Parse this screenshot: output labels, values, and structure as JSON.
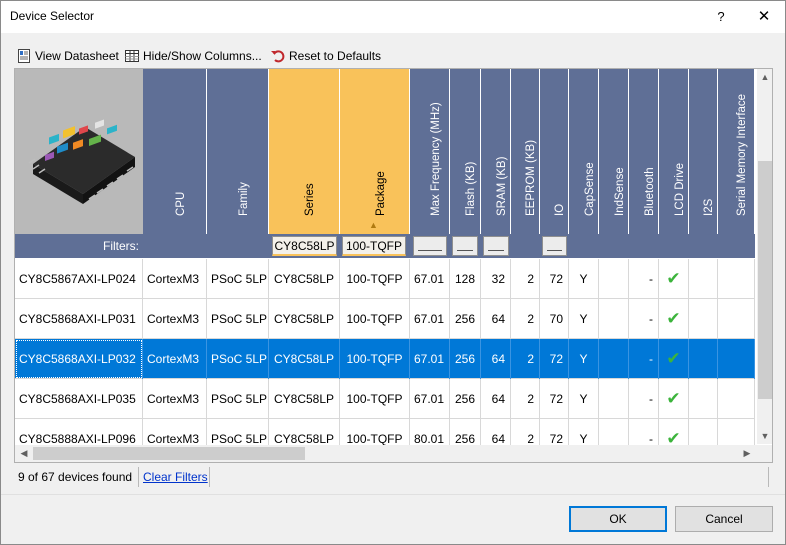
{
  "window": {
    "title": "Device Selector",
    "help_glyph": "?",
    "close_glyph": "✕"
  },
  "toolbar": {
    "view_datasheet": "View Datasheet",
    "hide_show_columns": "Hide/Show Columns...",
    "reset_defaults": "Reset to Defaults"
  },
  "columns": [
    "CPU",
    "Family",
    "Series",
    "Package",
    "Max Frequency (MHz)",
    "Flash (KB)",
    "SRAM (KB)",
    "EEPROM (KB)",
    "IO",
    "CapSense",
    "IndSense",
    "Bluetooth",
    "LCD Drive",
    "I2S",
    "Serial Memory Interface"
  ],
  "package_sort_glyph": "▲",
  "filters": {
    "label": "Filters:",
    "series": "CY8C58LP",
    "package": "100-TQFP"
  },
  "rows": [
    {
      "part": "CY8C5867AXI-LP024",
      "cpu": "CortexM3",
      "family": "PSoC 5LP",
      "series": "CY8C58LP",
      "package": "100-TQFP",
      "freq": "67.01",
      "flash": "128",
      "sram": "32",
      "eeprom": "2",
      "io": "72",
      "capsense": "Y",
      "bluetooth": "-",
      "lcd": "✔"
    },
    {
      "part": "CY8C5868AXI-LP031",
      "cpu": "CortexM3",
      "family": "PSoC 5LP",
      "series": "CY8C58LP",
      "package": "100-TQFP",
      "freq": "67.01",
      "flash": "256",
      "sram": "64",
      "eeprom": "2",
      "io": "70",
      "capsense": "Y",
      "bluetooth": "-",
      "lcd": "✔"
    },
    {
      "part": "CY8C5868AXI-LP032",
      "cpu": "CortexM3",
      "family": "PSoC 5LP",
      "series": "CY8C58LP",
      "package": "100-TQFP",
      "freq": "67.01",
      "flash": "256",
      "sram": "64",
      "eeprom": "2",
      "io": "72",
      "capsense": "Y",
      "bluetooth": "-",
      "lcd": "✔"
    },
    {
      "part": "CY8C5868AXI-LP035",
      "cpu": "CortexM3",
      "family": "PSoC 5LP",
      "series": "CY8C58LP",
      "package": "100-TQFP",
      "freq": "67.01",
      "flash": "256",
      "sram": "64",
      "eeprom": "2",
      "io": "72",
      "capsense": "Y",
      "bluetooth": "-",
      "lcd": "✔"
    },
    {
      "part": "CY8C5888AXI-LP096",
      "cpu": "CortexM3",
      "family": "PSoC 5LP",
      "series": "CY8C58LP",
      "package": "100-TQFP",
      "freq": "80.01",
      "flash": "256",
      "sram": "64",
      "eeprom": "2",
      "io": "72",
      "capsense": "Y",
      "bluetooth": "-",
      "lcd": "✔"
    }
  ],
  "selected_row": 2,
  "status": {
    "count": "9 of 67 devices found",
    "clear_filters": "Clear Filters"
  },
  "buttons": {
    "ok": "OK",
    "cancel": "Cancel"
  },
  "colors": {
    "header": "#5f6f96",
    "header_selected": "#f9c25a",
    "selection": "#0078d7",
    "check": "#3cb43c",
    "link": "#0033cc"
  },
  "icons": {
    "datasheet": "datasheet-icon",
    "columns": "columns-icon",
    "reset": "reset-icon",
    "chip": "chip-image"
  }
}
